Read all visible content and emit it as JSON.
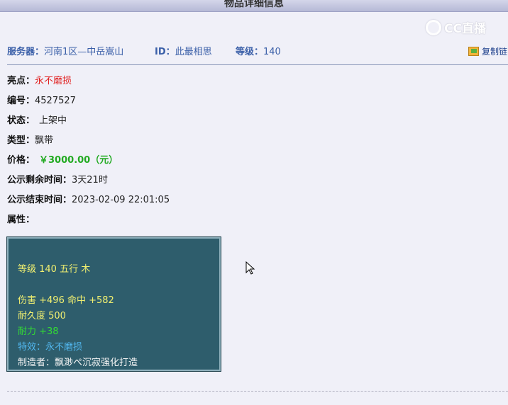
{
  "window": {
    "title": "物品详细信息"
  },
  "watermark": "CC直播",
  "info": {
    "server_label": "服务器：",
    "server_value": "河南1区—中岳嵩山",
    "id_label": "ID：",
    "id_value": "此最相思",
    "level_label": "等级：",
    "level_value": "140",
    "copy_link": "复制链"
  },
  "details": {
    "highlight_label": "亮点：",
    "highlight_value": "永不磨损",
    "number_label": "编号：",
    "number_value": "4527527",
    "status_label": "状态：",
    "status_value": "上架中",
    "type_label": "类型：",
    "type_value": "飘带",
    "price_label": "价格：",
    "price_value": "￥3000.00（元）",
    "remaining_label": "公示剩余时间：",
    "remaining_value": "3天21时",
    "end_label": "公示结束时间：",
    "end_value": "2023-02-09 22:01:05",
    "attr_label": "属性："
  },
  "attributes": {
    "level_element": "等级 140 五行 木",
    "damage_hit": "伤害 +496 命中 +582",
    "durability": "耐久度 500",
    "stamina": "耐力 +38",
    "special": "特效：永不磨损",
    "maker": "制造者：飘渺ぺ沉寂强化打造"
  },
  "colors": {
    "label_blue": "#3a5fa8",
    "highlight_red": "#e02020",
    "price_green": "#22aa22",
    "attr_bg": "#2e5d6c",
    "attr_yellow": "#f2f070",
    "attr_green": "#33dd33",
    "attr_blue": "#52b8f0"
  }
}
